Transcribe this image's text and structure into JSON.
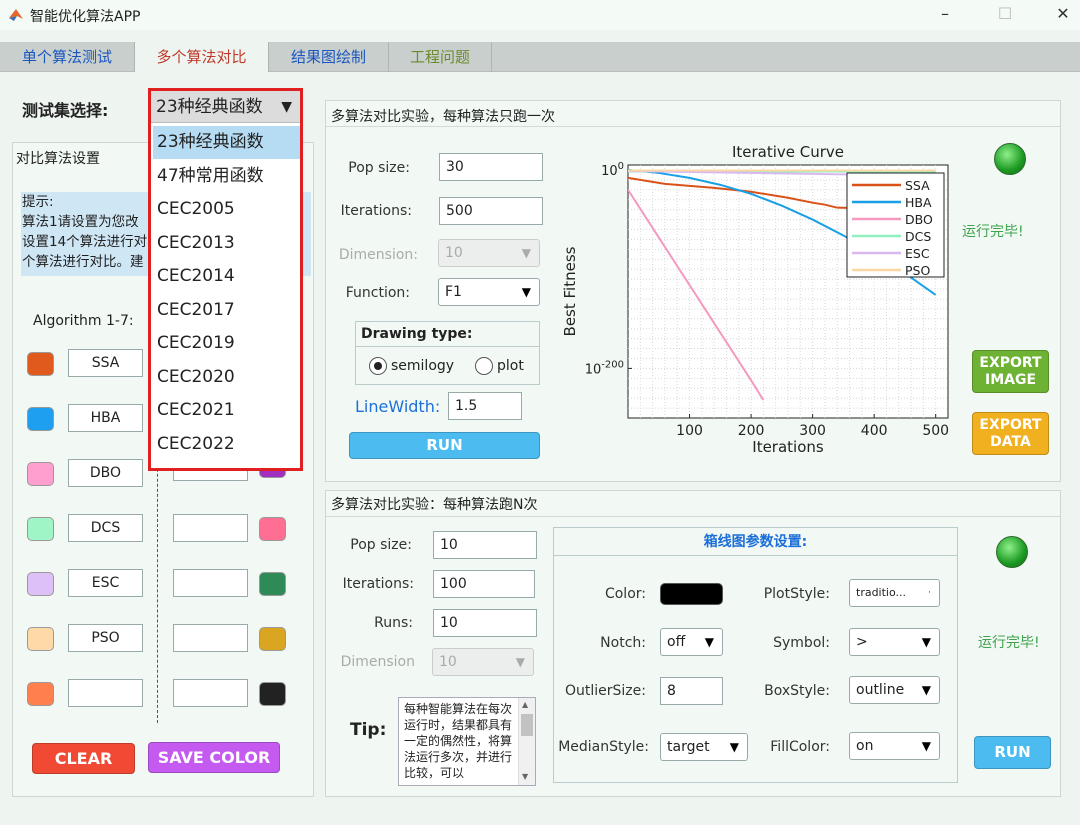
{
  "window": {
    "title": "智能优化算法APP",
    "controls": [
      "–",
      "☐",
      "✕"
    ]
  },
  "tabs": [
    {
      "label": "单个算法测试",
      "color": "#1a56c0"
    },
    {
      "label": "多个算法对比",
      "color": "#c0392b"
    },
    {
      "label": "结果图绘制",
      "color": "#1a56c0"
    },
    {
      "label": "工程问题",
      "color": "#6b8a2e"
    }
  ],
  "testset": {
    "label": "测试集选择:",
    "selected": "23种经典函数",
    "options": [
      "23种经典函数",
      "47种常用函数",
      "CEC2005",
      "CEC2013",
      "CEC2014",
      "CEC2017",
      "CEC2019",
      "CEC2020",
      "CEC2021",
      "CEC2022"
    ]
  },
  "left": {
    "title": "对比算法设置",
    "hint": [
      "提示:",
      "算法1请设置为您改",
      "设置14个算法进行对",
      "个算法进行对比。建"
    ],
    "algo_label": "Algorithm 1-7:",
    "col1": [
      {
        "color": "#e05a1e",
        "name": "SSA"
      },
      {
        "color": "#1e9ff0",
        "name": "HBA"
      },
      {
        "color": "#ff9fcf",
        "name": "DBO"
      },
      {
        "color": "#9ff5c6",
        "name": "DCS"
      },
      {
        "color": "#ddc0f5",
        "name": "ESC"
      },
      {
        "color": "#ffd9a8",
        "name": "PSO"
      },
      {
        "color": "#ff7f4f",
        "name": ""
      }
    ],
    "col2": [
      {
        "color": "#a030c0",
        "name": ""
      },
      {
        "color": "#ff6f93",
        "name": ""
      },
      {
        "color": "#2e8b57",
        "name": ""
      },
      {
        "color": "#daa520",
        "name": ""
      },
      {
        "color": "#222222",
        "name": ""
      }
    ],
    "clear": "CLEAR",
    "save_color": "SAVE COLOR"
  },
  "single": {
    "title": "多算法对比实验，每种算法只跑一次",
    "pop_label": "Pop size:",
    "pop": "30",
    "iter_label": "Iterations:",
    "iter": "500",
    "dim_label": "Dimension:",
    "dim": "10",
    "func_label": "Function:",
    "func": "F1",
    "draw_title": "Drawing type:",
    "semilogy": "semilogy",
    "plot": "plot",
    "lw_label": "LineWidth:",
    "lw": "1.5",
    "run": "RUN",
    "status": "运行完毕!",
    "export_image": "EXPORT\nIMAGE",
    "export_data": "EXPORT\nDATA"
  },
  "chart_data": {
    "type": "line",
    "title": "Iterative Curve",
    "xlabel": "Iterations",
    "ylabel": "Best Fitness",
    "xlim": [
      0,
      520
    ],
    "ylim": [
      -250,
      5
    ],
    "yscale": "log",
    "xticks": [
      100,
      200,
      300,
      400,
      500
    ],
    "yticks": [
      {
        "value": 0,
        "label": "10^0"
      },
      {
        "value": -200,
        "label": "10^-200"
      }
    ],
    "grid": true,
    "legend": "top-right",
    "series": [
      {
        "name": "SSA",
        "color": "#d95319",
        "x": [
          0,
          60,
          100,
          140,
          200,
          260,
          300,
          320,
          340,
          500
        ],
        "y": [
          -8,
          -14,
          -16,
          -18,
          -22,
          -28,
          -33,
          -35,
          -38,
          -40
        ]
      },
      {
        "name": "HBA",
        "color": "#1a9fe6",
        "x": [
          0,
          50,
          100,
          150,
          200,
          250,
          300,
          350,
          400,
          450,
          500
        ],
        "y": [
          0,
          -3,
          -8,
          -15,
          -24,
          -36,
          -50,
          -66,
          -84,
          -104,
          -126
        ]
      },
      {
        "name": "DBO",
        "color": "#f49ac1",
        "x": [
          0,
          50,
          100,
          150,
          200,
          220
        ],
        "y": [
          -20,
          -68,
          -116,
          -164,
          -212,
          -232
        ]
      },
      {
        "name": "DCS",
        "color": "#8ff0c0",
        "x": [
          0,
          500
        ],
        "y": [
          -1.5,
          -1.5
        ]
      },
      {
        "name": "ESC",
        "color": "#d9b8f2",
        "x": [
          0,
          100,
          200,
          300,
          400,
          500
        ],
        "y": [
          -1,
          -2,
          -3,
          -4,
          -5,
          -6
        ]
      },
      {
        "name": "PSO",
        "color": "#fbd7a4",
        "x": [
          0,
          500
        ],
        "y": [
          -0.5,
          -0.5
        ]
      }
    ]
  },
  "multi": {
    "title": "多算法对比实验：每种算法跑N次",
    "pop_label": "Pop size:",
    "pop": "10",
    "iter_label": "Iterations:",
    "iter": "100",
    "runs_label": "Runs:",
    "runs": "10",
    "dim_label": "Dimension",
    "dim": "10",
    "tip_label": "Tip:",
    "tip_text": "每种智能算法在每次运行时，结果都具有一定的偶然性，将算法运行多次，并进行比较，可以",
    "box_title": "箱线图参数设置:",
    "color_label": "Color:",
    "color_value": "#000000",
    "plotstyle_label": "PlotStyle:",
    "plotstyle": "traditio...",
    "notch_label": "Notch:",
    "notch": "off",
    "symbol_label": "Symbol:",
    "symbol": ">",
    "outlier_label": "OutlierSize:",
    "outlier": "8",
    "boxstyle_label": "BoxStyle:",
    "boxstyle": "outline",
    "median_label": "MedianStyle:",
    "median": "target",
    "fill_label": "FillColor:",
    "fill": "on",
    "run": "RUN",
    "status": "运行完毕!"
  }
}
